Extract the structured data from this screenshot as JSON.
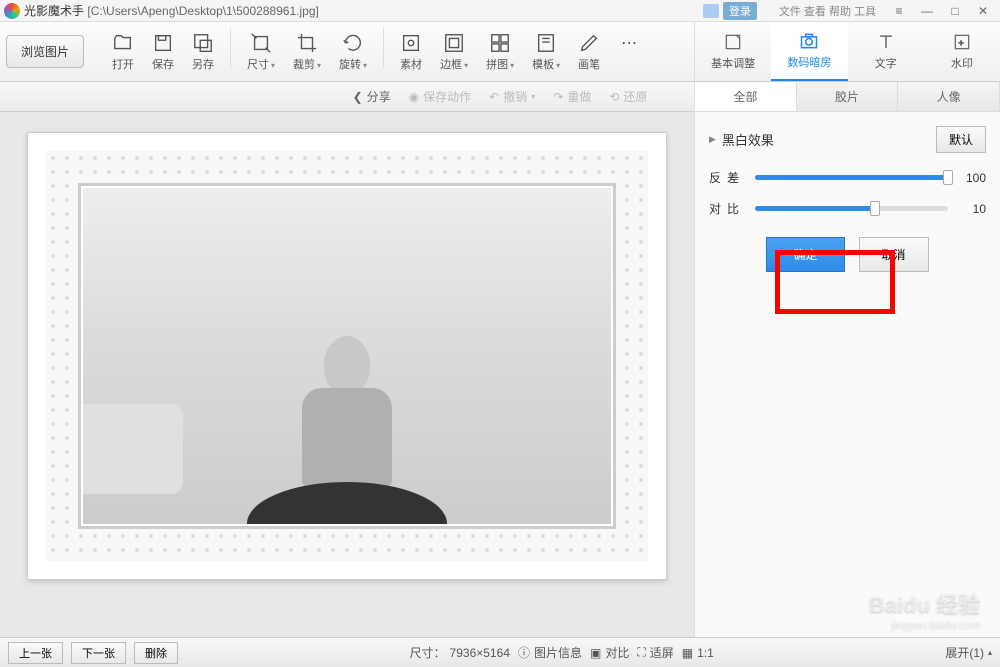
{
  "titlebar": {
    "app_name": "光影魔术手",
    "file_path": "[C:\\Users\\Apeng\\Desktop\\1\\500288961.jpg]",
    "login": "登录",
    "top_menu": "文件   查看   帮助   工具"
  },
  "toolbar": {
    "browse": "浏览图片",
    "items": [
      {
        "icon": "open",
        "label": "打开"
      },
      {
        "icon": "save",
        "label": "保存"
      },
      {
        "icon": "saveas",
        "label": "另存"
      },
      {
        "icon": "size",
        "label": "尺寸"
      },
      {
        "icon": "crop",
        "label": "裁剪"
      },
      {
        "icon": "rotate",
        "label": "旋转"
      },
      {
        "icon": "material",
        "label": "素材"
      },
      {
        "icon": "border",
        "label": "边框"
      },
      {
        "icon": "puzzle",
        "label": "拼图"
      },
      {
        "icon": "template",
        "label": "模板"
      },
      {
        "icon": "brush",
        "label": "画笔"
      },
      {
        "icon": "more",
        "label": ""
      }
    ]
  },
  "right_tabs": [
    {
      "icon": "adjust",
      "label": "基本调整"
    },
    {
      "icon": "darkroom",
      "label": "数码暗房",
      "active": true
    },
    {
      "icon": "text",
      "label": "文字"
    },
    {
      "icon": "watermark",
      "label": "水印"
    }
  ],
  "secondary": {
    "share": "分享",
    "save_action": "保存动作",
    "undo": "撤销",
    "redo": "重做",
    "restore": "还原"
  },
  "sub_tabs": [
    {
      "label": "全部",
      "active": true
    },
    {
      "label": "胶片"
    },
    {
      "label": "人像"
    }
  ],
  "effect": {
    "title": "黑白效果",
    "default_btn": "默认",
    "sliders": [
      {
        "label": "反差",
        "value": 100,
        "fill_pct": 100
      },
      {
        "label": "对比",
        "value": 10,
        "fill_pct": 62
      }
    ],
    "confirm": "确定",
    "cancel": "取消"
  },
  "statusbar": {
    "prev": "上一张",
    "next": "下一张",
    "delete": "删除",
    "size_label": "尺寸：",
    "size_value": "7936×5164",
    "info": "图片信息",
    "compare": "对比",
    "fit": "适屏",
    "onetoone": "1:1",
    "expand": "展开(1)"
  },
  "watermark": {
    "main": "Baidu 经验",
    "sub": "jingyan.baidu.com"
  }
}
